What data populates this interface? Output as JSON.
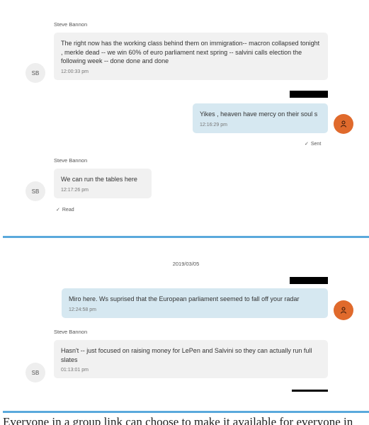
{
  "colors": {
    "accent": "#5aa9dc",
    "avatar_me": "#e06a2c",
    "incoming_bubble": "#f1f1f1",
    "outgoing_bubble": "#d6e8f1"
  },
  "thread1": {
    "msg1": {
      "sender": "Steve Bannon",
      "text": "The right now has the working class behind them on immigration-- macron collapsed tonight , merkle dead -- we win 60% of euro parliament next spring -- salvini calls election the following week -- done done and done",
      "time": "12:00:33 pm",
      "avatar": "SB"
    },
    "msg2": {
      "text": "Yikes , heaven have mercy on their soul s",
      "time": "12:16:29 pm",
      "status": "Sent",
      "avatar_icon": "person-icon"
    },
    "msg3": {
      "sender": "Steve Bannon",
      "text": "We can run the tables here",
      "time": "12:17:26 pm",
      "status": "Read",
      "avatar": "SB"
    }
  },
  "thread2": {
    "date": "2019/03/05",
    "msg1": {
      "text": "Miro  here.    Ws suprised that the European parliament seemed to fall off your radar",
      "time": "12:24:58 pm",
      "avatar_icon": "person-icon"
    },
    "msg2": {
      "sender": "Steve Bannon",
      "text": "Hasn't -- just focused on raising money for LePen and Salvini so they can actually run full slates",
      "time": "01:13:01 pm",
      "avatar": "SB"
    }
  },
  "footer": {
    "text": "Everyone in a group link can choose to make it available for everyone in"
  }
}
